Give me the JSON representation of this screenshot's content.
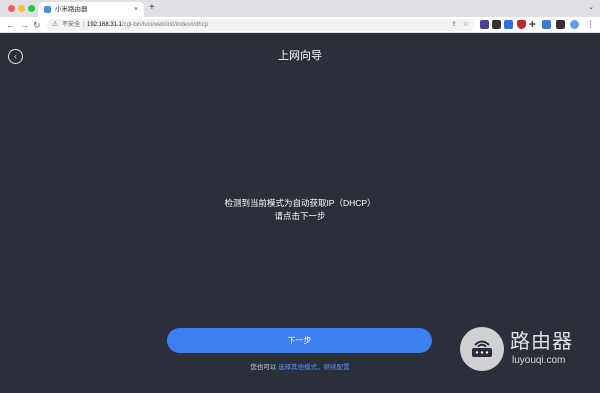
{
  "browser": {
    "tab_title": "小米路由器",
    "tab_close": "×",
    "new_tab": "+",
    "security_label": "不安全",
    "url_host": "192.168.31.1",
    "url_path": "/cgi-bin/luci/web/init/index#/dhcp"
  },
  "header": {
    "back_icon": "‹",
    "title": "上网向导"
  },
  "main": {
    "message_line1": "检测到当前模式为自动获取IP（DHCP）",
    "message_line2": "请点击下一步",
    "next_button_label": "下一步",
    "hint_prefix": "您也可以",
    "hint_link": "选择其他模式，继续配置"
  },
  "watermark": {
    "brand": "路由器",
    "domain": "luyouqi.com"
  },
  "colors": {
    "page_background": "#2b2f3a",
    "primary_button": "#3d7ef0",
    "link": "#5b8ff6"
  }
}
